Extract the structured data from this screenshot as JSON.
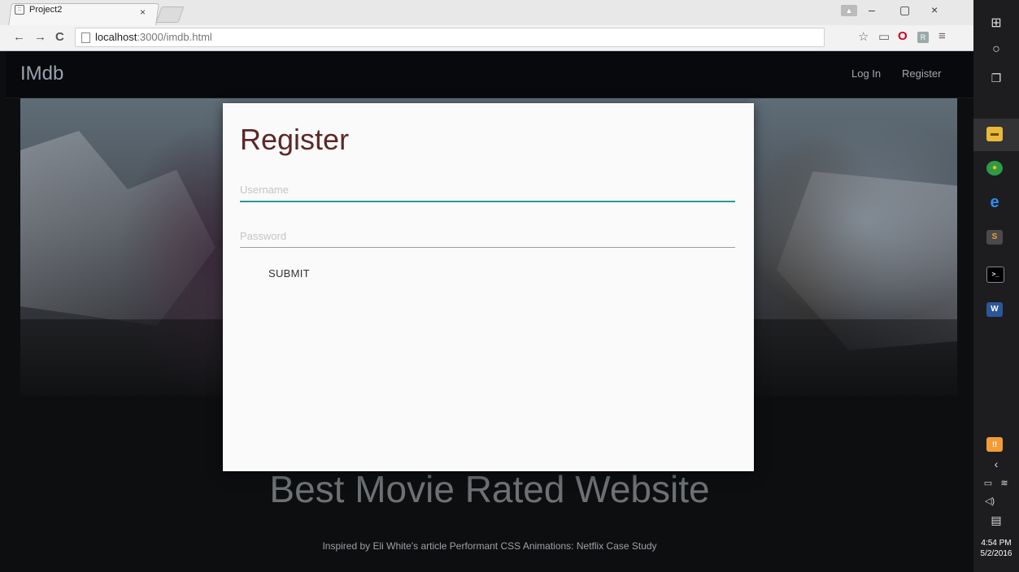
{
  "browser": {
    "tab_title": "Project2",
    "tab_favicon_glyph": "::",
    "tab_close_glyph": "×",
    "url_host": "localhost",
    "url_rest": ":3000/imdb.html",
    "icons": {
      "back": "←",
      "forward": "→",
      "reload": "C",
      "star": "☆",
      "cast": "▭",
      "opera": "O",
      "ext": "R",
      "menu": "≡",
      "minimize": "–",
      "restore": "▢",
      "close": "×",
      "user": "▲"
    }
  },
  "site": {
    "brand": "IMdb",
    "nav": {
      "login": "Log In",
      "register": "Register"
    },
    "headline": "Best Movie Rated Website",
    "footer_text": "Inspired by Eli White's article Performant CSS Animations: Netflix Case Study"
  },
  "modal": {
    "title": "Register",
    "username_placeholder": "Username",
    "password_placeholder": "Password",
    "submit_label": "SUBMIT"
  },
  "taskbar": {
    "icons": {
      "start": "⊞",
      "cortana": "○",
      "taskview": "❐",
      "explorer": "▬",
      "chrome": "●",
      "edge": "e",
      "sublime": "S",
      "cmd": ">_",
      "word": "W",
      "tray_chevron": "‹",
      "battery": "▭",
      "wifi": "≋",
      "volume": "◁)",
      "notifications": "▤",
      "alert": "!!"
    },
    "time": "4:54 PM",
    "date": "5/2/2016"
  },
  "colors": {
    "accent_teal": "#279a93",
    "modal_title": "#5b2826"
  }
}
